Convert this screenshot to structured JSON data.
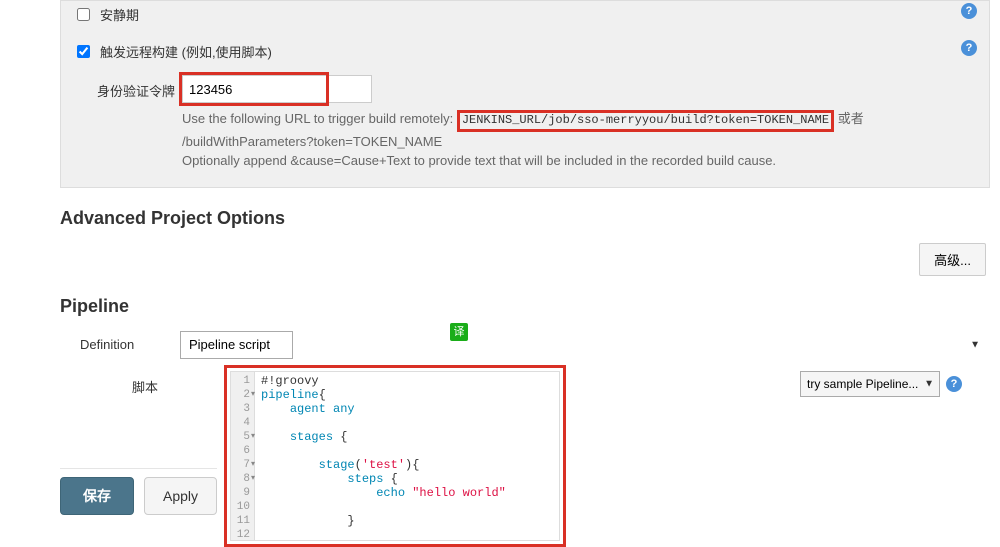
{
  "triggers": {
    "quiet_period_label": "安静期",
    "remote_trigger_label": "触发远程构建 (例如,使用脚本)",
    "token_label": "身份验证令牌",
    "token_value": "123456",
    "hint_line1_prefix": "Use the following URL to trigger build remotely: ",
    "hint_url": "JENKINS_URL/job/sso-merryyou/build?token=TOKEN_NAME",
    "hint_line1_suffix": " 或者 /buildWithParameters?token=TOKEN_NAME",
    "hint_line2": "Optionally append &cause=Cause+Text to provide text that will be included in the recorded build cause."
  },
  "advanced": {
    "header": "Advanced Project Options",
    "button": "高级..."
  },
  "pipeline": {
    "header": "Pipeline",
    "definition_label": "Definition",
    "definition_value": "Pipeline script",
    "translate_badge": "译",
    "script_label": "脚本",
    "code_lines": [
      "#!groovy",
      "pipeline{",
      "    agent any",
      "",
      "    stages {",
      "",
      "        stage('test'){",
      "            steps {",
      "                echo \"hello world\"",
      "",
      "            }"
    ],
    "line_numbers": [
      "1",
      "2",
      "3",
      "4",
      "5",
      "6",
      "7",
      "8",
      "9",
      "10",
      "11",
      "12"
    ],
    "fold_lines": [
      2,
      5,
      7,
      8
    ],
    "sample_label": "try sample Pipeline..."
  },
  "footer": {
    "save": "保存",
    "apply": "Apply"
  }
}
